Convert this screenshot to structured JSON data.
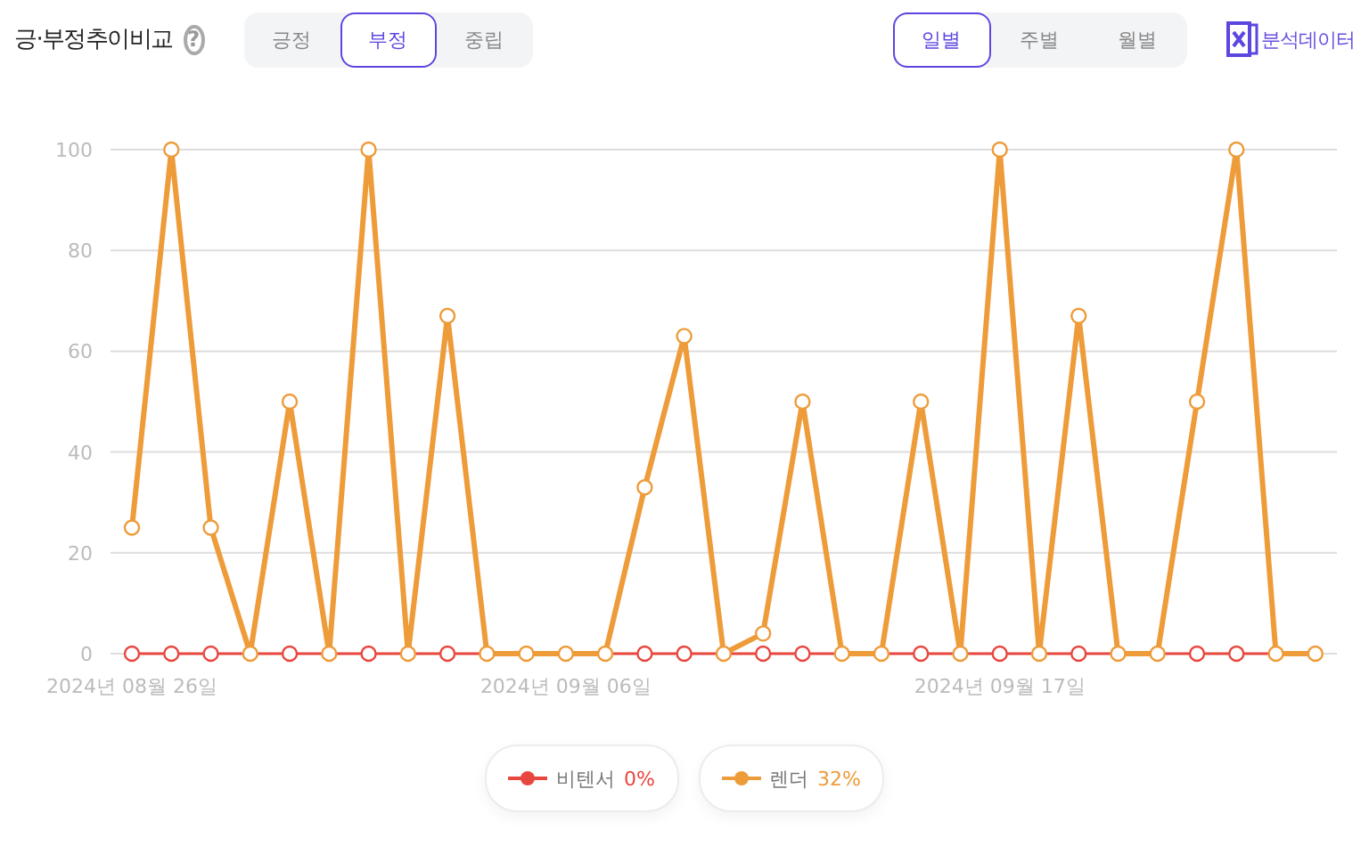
{
  "header": {
    "title": "긍·부정추이비교",
    "help_icon": "?"
  },
  "sentiment_tabs": [
    {
      "label": "긍정",
      "selected": false
    },
    {
      "label": "부정",
      "selected": true
    },
    {
      "label": "중립",
      "selected": false
    }
  ],
  "period_tabs": [
    {
      "label": "일별",
      "selected": true
    },
    {
      "label": "주별",
      "selected": false
    },
    {
      "label": "월별",
      "selected": false
    }
  ],
  "export_link": {
    "label": "분석데이터"
  },
  "chart": {
    "chart_data": {
      "type": "line",
      "categories": [
        "2024년 08월 26일",
        null,
        null,
        null,
        null,
        null,
        null,
        null,
        null,
        null,
        null,
        "2024년 09월 06일",
        null,
        null,
        null,
        null,
        null,
        null,
        null,
        null,
        null,
        null,
        "2024년 09월 17일",
        null,
        null,
        null,
        null,
        null,
        null,
        null,
        null
      ],
      "grid": true,
      "ylim": [
        0,
        100
      ],
      "yticks": [
        0,
        20,
        40,
        60,
        80,
        100
      ],
      "series": [
        {
          "name": "비텐서",
          "color": "#e8473f",
          "values": [
            0,
            0,
            0,
            0,
            0,
            0,
            0,
            0,
            0,
            0,
            0,
            0,
            0,
            0,
            0,
            0,
            0,
            0,
            0,
            0,
            0,
            0,
            0,
            0,
            0,
            0,
            0,
            0,
            0,
            0,
            0
          ]
        },
        {
          "name": "렌더",
          "color": "#ee9b3a",
          "marker": "circle",
          "values": [
            25,
            100,
            25,
            0,
            50,
            0,
            100,
            0,
            67,
            0,
            0,
            0,
            0,
            33,
            63,
            0,
            4,
            50,
            0,
            0,
            50,
            0,
            100,
            0,
            67,
            0,
            0,
            50,
            100,
            0,
            0
          ]
        }
      ]
    }
  },
  "legend": [
    {
      "share": "0%"
    },
    {
      "share": "32%"
    }
  ]
}
